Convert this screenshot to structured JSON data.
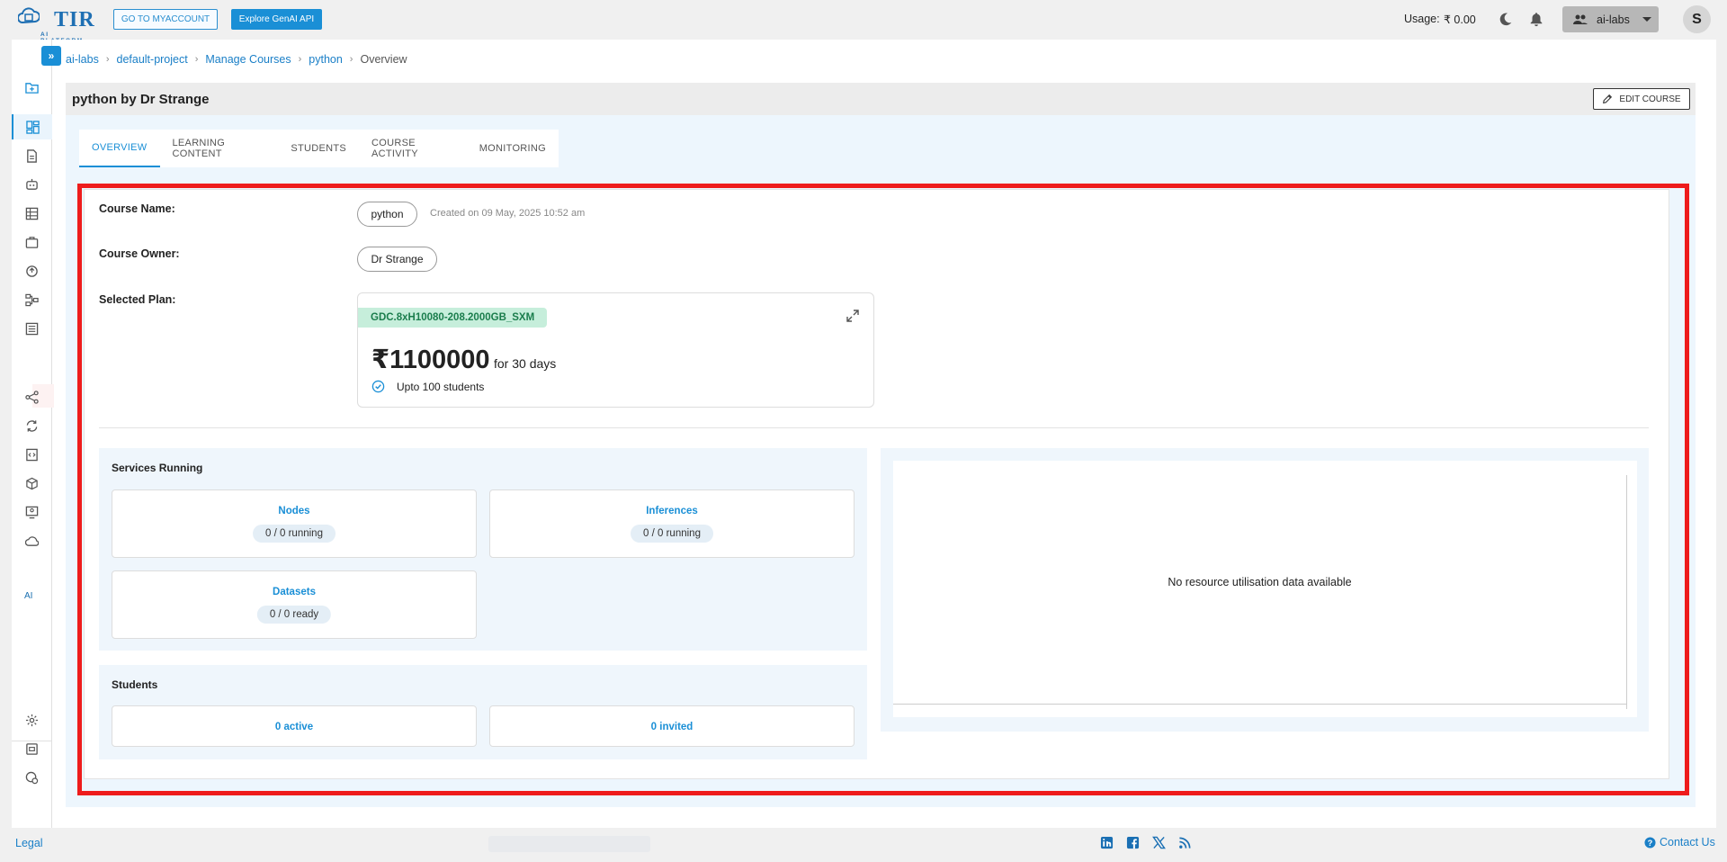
{
  "topbar": {
    "logo_text": "TIR",
    "logo_sub": "AI PLATFORM",
    "myaccount_label": "GO TO MYACCOUNT",
    "genai_label": "Explore GenAI API",
    "usage_label": "Usage:",
    "usage_value": "₹ 0.00",
    "team_label": "ai-labs",
    "avatar_initial": "S"
  },
  "rail": {
    "ai_label": "AI"
  },
  "breadcrumb": {
    "items": [
      "ai-labs",
      "default-project",
      "Manage Courses",
      "python"
    ],
    "current": "Overview"
  },
  "course": {
    "title": "python by Dr Strange",
    "edit_label": "EDIT COURSE",
    "tabs": [
      "OVERVIEW",
      "LEARNING CONTENT",
      "STUDENTS",
      "COURSE ACTIVITY",
      "MONITORING"
    ],
    "active_tab": "OVERVIEW"
  },
  "overview": {
    "course_name_label": "Course Name:",
    "course_name": "python",
    "created": "Created on 09 May, 2025 10:52 am",
    "owner_label": "Course Owner:",
    "owner": "Dr Strange",
    "plan_label": "Selected Plan:",
    "plan": {
      "sku": "GDC.8xH10080-208.2000GB_SXM",
      "price": "₹1100000",
      "period": "for 30 days",
      "feature": "Upto 100 students"
    },
    "services": {
      "title": "Services Running",
      "nodes_title": "Nodes",
      "nodes_value": "0 / 0 running",
      "inferences_title": "Inferences",
      "inferences_value": "0 / 0 running",
      "datasets_title": "Datasets",
      "datasets_value": "0 / 0 ready"
    },
    "students": {
      "title": "Students",
      "active": "0 active",
      "invited": "0 invited"
    },
    "utilisation_message": "No resource utilisation data available"
  },
  "footer": {
    "legal": "Legal",
    "contact": "Contact Us"
  },
  "colors": {
    "accent": "#1a8fd6",
    "highlight": "#ee1c1c",
    "plan_tag_bg": "#c6eedb"
  }
}
